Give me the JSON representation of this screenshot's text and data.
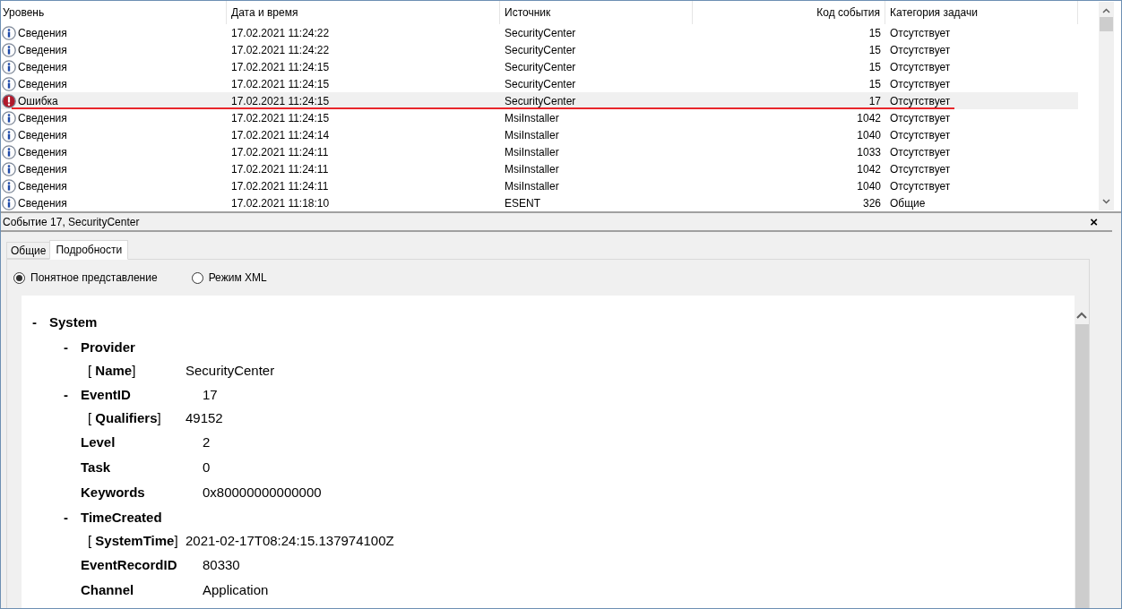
{
  "events_table": {
    "columns": [
      "Уровень",
      "Дата и время",
      "Источник",
      "Код события",
      "Категория задачи"
    ],
    "rows": [
      {
        "kind": "info",
        "level": "Сведения",
        "datetime": "17.02.2021 11:24:22",
        "source": "SecurityCenter",
        "event_id": "15",
        "category": "Отсутствует",
        "selected": false
      },
      {
        "kind": "info",
        "level": "Сведения",
        "datetime": "17.02.2021 11:24:22",
        "source": "SecurityCenter",
        "event_id": "15",
        "category": "Отсутствует",
        "selected": false
      },
      {
        "kind": "info",
        "level": "Сведения",
        "datetime": "17.02.2021 11:24:15",
        "source": "SecurityCenter",
        "event_id": "15",
        "category": "Отсутствует",
        "selected": false
      },
      {
        "kind": "info",
        "level": "Сведения",
        "datetime": "17.02.2021 11:24:15",
        "source": "SecurityCenter",
        "event_id": "15",
        "category": "Отсутствует",
        "selected": false
      },
      {
        "kind": "error",
        "level": "Ошибка",
        "datetime": "17.02.2021 11:24:15",
        "source": "SecurityCenter",
        "event_id": "17",
        "category": "Отсутствует",
        "selected": true
      },
      {
        "kind": "info",
        "level": "Сведения",
        "datetime": "17.02.2021 11:24:15",
        "source": "MsiInstaller",
        "event_id": "1042",
        "category": "Отсутствует",
        "selected": false
      },
      {
        "kind": "info",
        "level": "Сведения",
        "datetime": "17.02.2021 11:24:14",
        "source": "MsiInstaller",
        "event_id": "1040",
        "category": "Отсутствует",
        "selected": false
      },
      {
        "kind": "info",
        "level": "Сведения",
        "datetime": "17.02.2021 11:24:11",
        "source": "MsiInstaller",
        "event_id": "1033",
        "category": "Отсутствует",
        "selected": false
      },
      {
        "kind": "info",
        "level": "Сведения",
        "datetime": "17.02.2021 11:24:11",
        "source": "MsiInstaller",
        "event_id": "1042",
        "category": "Отсутствует",
        "selected": false
      },
      {
        "kind": "info",
        "level": "Сведения",
        "datetime": "17.02.2021 11:24:11",
        "source": "MsiInstaller",
        "event_id": "1040",
        "category": "Отсутствует",
        "selected": false
      },
      {
        "kind": "info",
        "level": "Сведения",
        "datetime": "17.02.2021 11:18:10",
        "source": "ESENT",
        "event_id": "326",
        "category": "Общие",
        "selected": false
      }
    ]
  },
  "detail_pane": {
    "title": "Событие 17, SecurityCenter",
    "close": "×",
    "tabs": [
      {
        "label": "Общие",
        "selected": false
      },
      {
        "label": "Подробности",
        "selected": true
      }
    ],
    "view_modes": [
      {
        "label": "Понятное представление",
        "selected": true
      },
      {
        "label": "Режим XML",
        "selected": false
      }
    ],
    "tree": [
      {
        "kind": "group",
        "toggle": "-",
        "label": "System",
        "children": [
          {
            "kind": "group",
            "toggle": "-",
            "label": "Provider",
            "children": [
              {
                "kind": "attribute",
                "label": "[ **Name**]",
                "value": "SecurityCenter"
              }
            ]
          },
          {
            "kind": "group",
            "toggle": "-",
            "label": "EventID",
            "value": "17",
            "children": [
              {
                "kind": "attribute",
                "label": "[ **Qualifiers**]",
                "value": "49152"
              }
            ]
          },
          {
            "kind": "field",
            "label": "Level",
            "value": "2"
          },
          {
            "kind": "field",
            "label": "Task",
            "value": "0"
          },
          {
            "kind": "field",
            "label": "Keywords",
            "value": "0x80000000000000"
          },
          {
            "kind": "group",
            "toggle": "-",
            "label": "TimeCreated",
            "children": [
              {
                "kind": "attribute",
                "label": "[ **SystemTime**]",
                "value": "2021-02-17T08:24:15.137974100Z"
              }
            ]
          },
          {
            "kind": "field",
            "label": "EventRecordID",
            "value": "80330"
          },
          {
            "kind": "field",
            "label": "Channel",
            "value": "Application"
          }
        ]
      }
    ]
  }
}
